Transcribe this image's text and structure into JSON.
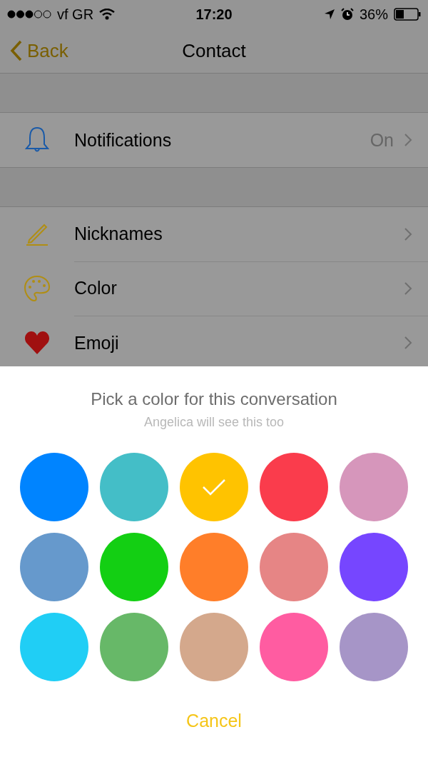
{
  "status_bar": {
    "carrier": "vf GR",
    "time": "17:20",
    "battery": "36%"
  },
  "nav": {
    "back": "Back",
    "title": "Contact"
  },
  "sections": [
    {
      "rows": [
        {
          "kind": "bell",
          "label": "Notifications",
          "value": "On"
        }
      ]
    },
    {
      "rows": [
        {
          "kind": "pencil",
          "label": "Nicknames"
        },
        {
          "kind": "palette",
          "label": "Color"
        },
        {
          "kind": "heart",
          "label": "Emoji"
        }
      ]
    }
  ],
  "sheet": {
    "title": "Pick a color for this conversation",
    "subtitle": "Angelica will see this too",
    "cancel": "Cancel",
    "colors": [
      {
        "color": "#0084ff",
        "selected": false
      },
      {
        "color": "#44bec7",
        "selected": false
      },
      {
        "color": "#ffc300",
        "selected": true
      },
      {
        "color": "#fa3c4c",
        "selected": false
      },
      {
        "color": "#d696bb",
        "selected": false
      },
      {
        "color": "#6699cc",
        "selected": false
      },
      {
        "color": "#13cf13",
        "selected": false
      },
      {
        "color": "#ff7e29",
        "selected": false
      },
      {
        "color": "#e68585",
        "selected": false
      },
      {
        "color": "#7646ff",
        "selected": false
      },
      {
        "color": "#20cef5",
        "selected": false
      },
      {
        "color": "#67b868",
        "selected": false
      },
      {
        "color": "#d4a88c",
        "selected": false
      },
      {
        "color": "#ff5ca1",
        "selected": false
      },
      {
        "color": "#a695c7",
        "selected": false
      }
    ]
  }
}
